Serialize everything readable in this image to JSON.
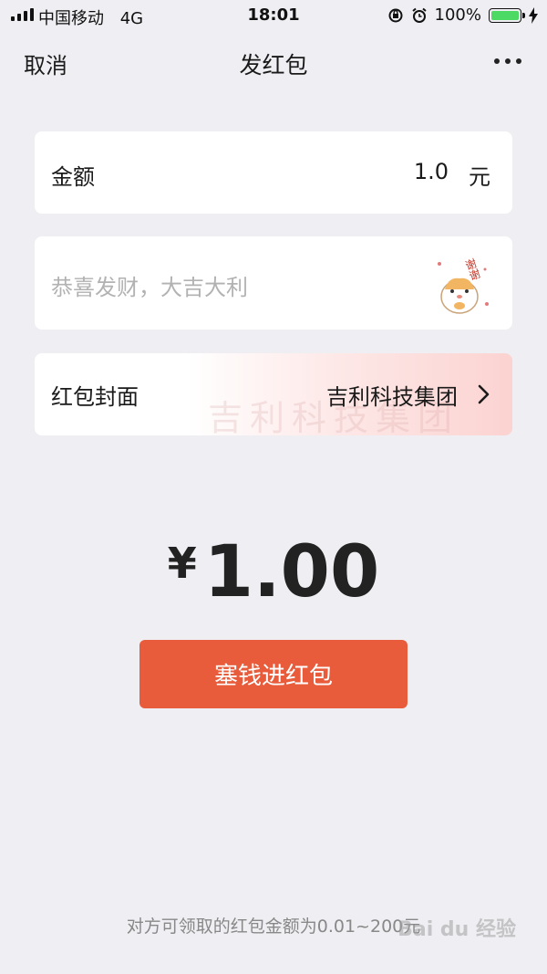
{
  "status_bar": {
    "carrier": "中国移动",
    "network": "4G",
    "time": "18:01",
    "battery_percent": "100%",
    "battery_level": 1.0,
    "icons": [
      "signal-icon",
      "orientation-lock-icon",
      "alarm-icon",
      "battery-icon",
      "charging-icon"
    ]
  },
  "nav": {
    "cancel_label": "取消",
    "title": "发红包",
    "more_icon": "more-icon"
  },
  "amount": {
    "label": "金额",
    "value": "1.0",
    "unit": "元"
  },
  "greeting": {
    "placeholder": "恭喜发财，大吉大利",
    "sticker_text": "谢谢"
  },
  "cover": {
    "label": "红包封面",
    "value": "吉利科技集团",
    "watermark": "吉利科技集团"
  },
  "total": {
    "currency": "¥",
    "value": "1.00"
  },
  "submit_label": "塞钱进红包",
  "hint": "对方可领取的红包金额为0.01~200元",
  "watermark_logo": "Baidu经验",
  "colors": {
    "background": "#EFEEF2",
    "accent": "#E85C3B",
    "battery": "#4CD964"
  }
}
